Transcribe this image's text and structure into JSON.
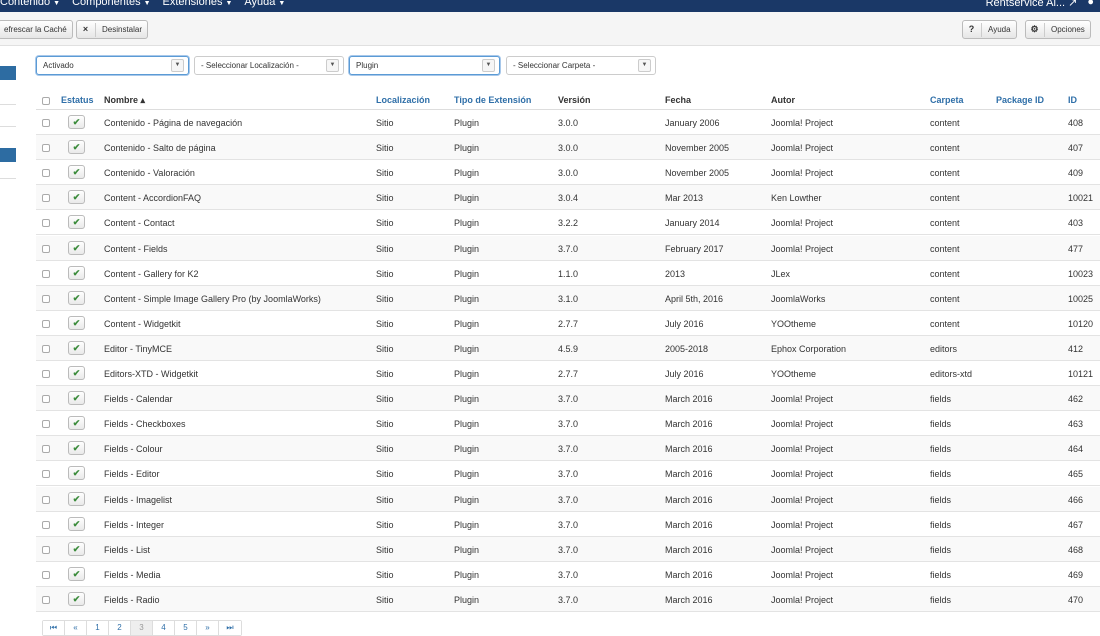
{
  "topnav": {
    "menu": [
      "Contenido",
      "Componentes",
      "Extensiones",
      "Ayuda"
    ],
    "site": "Rentservice Al...",
    "external_icon": "external-link-icon",
    "user_icon": "user-icon"
  },
  "toolbar": {
    "refresh_label": "efrescar la Caché",
    "uninstall_label": "Desinstalar",
    "uninstall_icon": "×",
    "help_label": "Ayuda",
    "help_icon": "?",
    "options_label": "Opciones",
    "options_icon": "⚙"
  },
  "filters": {
    "status": "Activado",
    "location": "- Seleccionar Localización -",
    "type": "Plugin",
    "folder": "- Seleccionar Carpeta -"
  },
  "table": {
    "headers": {
      "status": "Estatus",
      "name": "Nombre ▴",
      "location": "Localización",
      "type": "Tipo de Extensión",
      "version": "Versión",
      "date": "Fecha",
      "author": "Autor",
      "folder": "Carpeta",
      "package": "Package ID",
      "id": "ID"
    },
    "rows": [
      {
        "name": "Contenido - Página de navegación",
        "location": "Sitio",
        "type": "Plugin",
        "version": "3.0.0",
        "date": "January 2006",
        "author": "Joomla! Project",
        "folder": "content",
        "id": "408"
      },
      {
        "name": "Contenido - Salto de página",
        "location": "Sitio",
        "type": "Plugin",
        "version": "3.0.0",
        "date": "November 2005",
        "author": "Joomla! Project",
        "folder": "content",
        "id": "407"
      },
      {
        "name": "Contenido - Valoración",
        "location": "Sitio",
        "type": "Plugin",
        "version": "3.0.0",
        "date": "November 2005",
        "author": "Joomla! Project",
        "folder": "content",
        "id": "409"
      },
      {
        "name": "Content - AccordionFAQ",
        "location": "Sitio",
        "type": "Plugin",
        "version": "3.0.4",
        "date": "Mar 2013",
        "author": "Ken Lowther",
        "folder": "content",
        "id": "10021"
      },
      {
        "name": "Content - Contact",
        "location": "Sitio",
        "type": "Plugin",
        "version": "3.2.2",
        "date": "January 2014",
        "author": "Joomla! Project",
        "folder": "content",
        "id": "403"
      },
      {
        "name": "Content - Fields",
        "location": "Sitio",
        "type": "Plugin",
        "version": "3.7.0",
        "date": "February 2017",
        "author": "Joomla! Project",
        "folder": "content",
        "id": "477"
      },
      {
        "name": "Content - Gallery for K2",
        "location": "Sitio",
        "type": "Plugin",
        "version": "1.1.0",
        "date": "2013",
        "author": "JLex",
        "folder": "content",
        "id": "10023"
      },
      {
        "name": "Content - Simple Image Gallery Pro (by JoomlaWorks)",
        "location": "Sitio",
        "type": "Plugin",
        "version": "3.1.0",
        "date": "April 5th, 2016",
        "author": "JoomlaWorks",
        "folder": "content",
        "id": "10025"
      },
      {
        "name": "Content - Widgetkit",
        "location": "Sitio",
        "type": "Plugin",
        "version": "2.7.7",
        "date": "July 2016",
        "author": "YOOtheme",
        "folder": "content",
        "id": "10120"
      },
      {
        "name": "Editor - TinyMCE",
        "location": "Sitio",
        "type": "Plugin",
        "version": "4.5.9",
        "date": "2005-2018",
        "author": "Ephox Corporation",
        "folder": "editors",
        "id": "412"
      },
      {
        "name": "Editors-XTD - Widgetkit",
        "location": "Sitio",
        "type": "Plugin",
        "version": "2.7.7",
        "date": "July 2016",
        "author": "YOOtheme",
        "folder": "editors-xtd",
        "id": "10121"
      },
      {
        "name": "Fields - Calendar",
        "location": "Sitio",
        "type": "Plugin",
        "version": "3.7.0",
        "date": "March 2016",
        "author": "Joomla! Project",
        "folder": "fields",
        "id": "462"
      },
      {
        "name": "Fields - Checkboxes",
        "location": "Sitio",
        "type": "Plugin",
        "version": "3.7.0",
        "date": "March 2016",
        "author": "Joomla! Project",
        "folder": "fields",
        "id": "463"
      },
      {
        "name": "Fields - Colour",
        "location": "Sitio",
        "type": "Plugin",
        "version": "3.7.0",
        "date": "March 2016",
        "author": "Joomla! Project",
        "folder": "fields",
        "id": "464"
      },
      {
        "name": "Fields - Editor",
        "location": "Sitio",
        "type": "Plugin",
        "version": "3.7.0",
        "date": "March 2016",
        "author": "Joomla! Project",
        "folder": "fields",
        "id": "465"
      },
      {
        "name": "Fields - Imagelist",
        "location": "Sitio",
        "type": "Plugin",
        "version": "3.7.0",
        "date": "March 2016",
        "author": "Joomla! Project",
        "folder": "fields",
        "id": "466"
      },
      {
        "name": "Fields - Integer",
        "location": "Sitio",
        "type": "Plugin",
        "version": "3.7.0",
        "date": "March 2016",
        "author": "Joomla! Project",
        "folder": "fields",
        "id": "467"
      },
      {
        "name": "Fields - List",
        "location": "Sitio",
        "type": "Plugin",
        "version": "3.7.0",
        "date": "March 2016",
        "author": "Joomla! Project",
        "folder": "fields",
        "id": "468"
      },
      {
        "name": "Fields - Media",
        "location": "Sitio",
        "type": "Plugin",
        "version": "3.7.0",
        "date": "March 2016",
        "author": "Joomla! Project",
        "folder": "fields",
        "id": "469"
      },
      {
        "name": "Fields - Radio",
        "location": "Sitio",
        "type": "Plugin",
        "version": "3.7.0",
        "date": "March 2016",
        "author": "Joomla! Project",
        "folder": "fields",
        "id": "470"
      }
    ]
  },
  "pagination": {
    "first": "⏮",
    "prev": "«",
    "pages": [
      "1",
      "2",
      "3",
      "4",
      "5"
    ],
    "current": "3",
    "next": "»",
    "last": "⏭"
  }
}
